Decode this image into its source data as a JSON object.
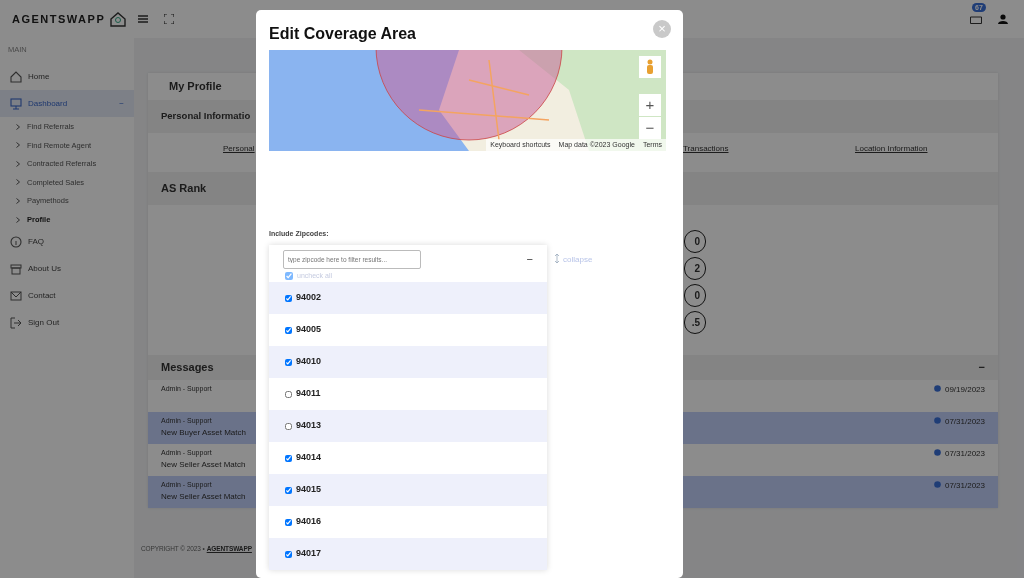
{
  "topbar": {
    "logo": "AGENTSWAPP",
    "notification_count": "67"
  },
  "sidebar": {
    "section": "MAIN",
    "items": [
      {
        "label": "Home",
        "selected": false
      },
      {
        "label": "Dashboard",
        "selected": true,
        "expanded": true,
        "toggle": "−",
        "children": [
          {
            "label": "Find Referrals",
            "selected": false
          },
          {
            "label": "Find Remote Agent",
            "selected": false
          },
          {
            "label": "Contracted Referrals",
            "selected": false
          },
          {
            "label": "Completed Sales",
            "selected": false
          },
          {
            "label": "Paymethods",
            "selected": false
          },
          {
            "label": "Profile",
            "selected": true
          }
        ]
      },
      {
        "label": "FAQ",
        "selected": false
      },
      {
        "label": "About Us",
        "selected": false
      },
      {
        "label": "Contact",
        "selected": false
      },
      {
        "label": "Sign Out",
        "selected": false
      }
    ]
  },
  "profile": {
    "title": "My Profile",
    "personal_header": "Personal Informatio",
    "tabs": [
      {
        "label": "Personal"
      },
      {
        "label": "Transactions"
      },
      {
        "label": "Location Information"
      }
    ],
    "rank_header": "AS Rank",
    "rank_values": [
      "0",
      "2",
      "0",
      ".5"
    ],
    "messages": {
      "header": "Messages",
      "toggle": "−",
      "rows": [
        {
          "sender": "Admin - Support",
          "subject": "",
          "date": "09/19/2023",
          "unread": false
        },
        {
          "sender": "Admin - Support",
          "subject": "New Buyer Asset Match",
          "date": "07/31/2023",
          "unread": true
        },
        {
          "sender": "Admin - Support",
          "subject": "New Seller Asset Match",
          "date": "07/31/2023",
          "unread": false
        },
        {
          "sender": "Admin - Support",
          "subject": "New Seller Asset Match",
          "date": "07/31/2023",
          "unread": true
        }
      ]
    }
  },
  "footer": {
    "copyright": "COPYRIGHT © 2023 •",
    "link": "AGENTSWAPP"
  },
  "modal": {
    "title": "Edit Coverage Area",
    "close": "×",
    "map": {
      "zoom_in": "+",
      "zoom_out": "−",
      "attribution": [
        "Keyboard shortcuts",
        "Map data ©2023 Google",
        "Terms"
      ]
    },
    "zip_label": "Include Zipcodes:",
    "filter_placeholder": "type zipcode here to filter results...",
    "toggle": "−",
    "uncheck_all": {
      "label": "uncheck all",
      "checked": true
    },
    "collapse_link": "collapse",
    "zipcodes": [
      {
        "code": "94002",
        "checked": true
      },
      {
        "code": "94005",
        "checked": true
      },
      {
        "code": "94010",
        "checked": true
      },
      {
        "code": "94011",
        "checked": false
      },
      {
        "code": "94013",
        "checked": false
      },
      {
        "code": "94014",
        "checked": true
      },
      {
        "code": "94015",
        "checked": true
      },
      {
        "code": "94016",
        "checked": true
      },
      {
        "code": "94017",
        "checked": true
      }
    ]
  }
}
